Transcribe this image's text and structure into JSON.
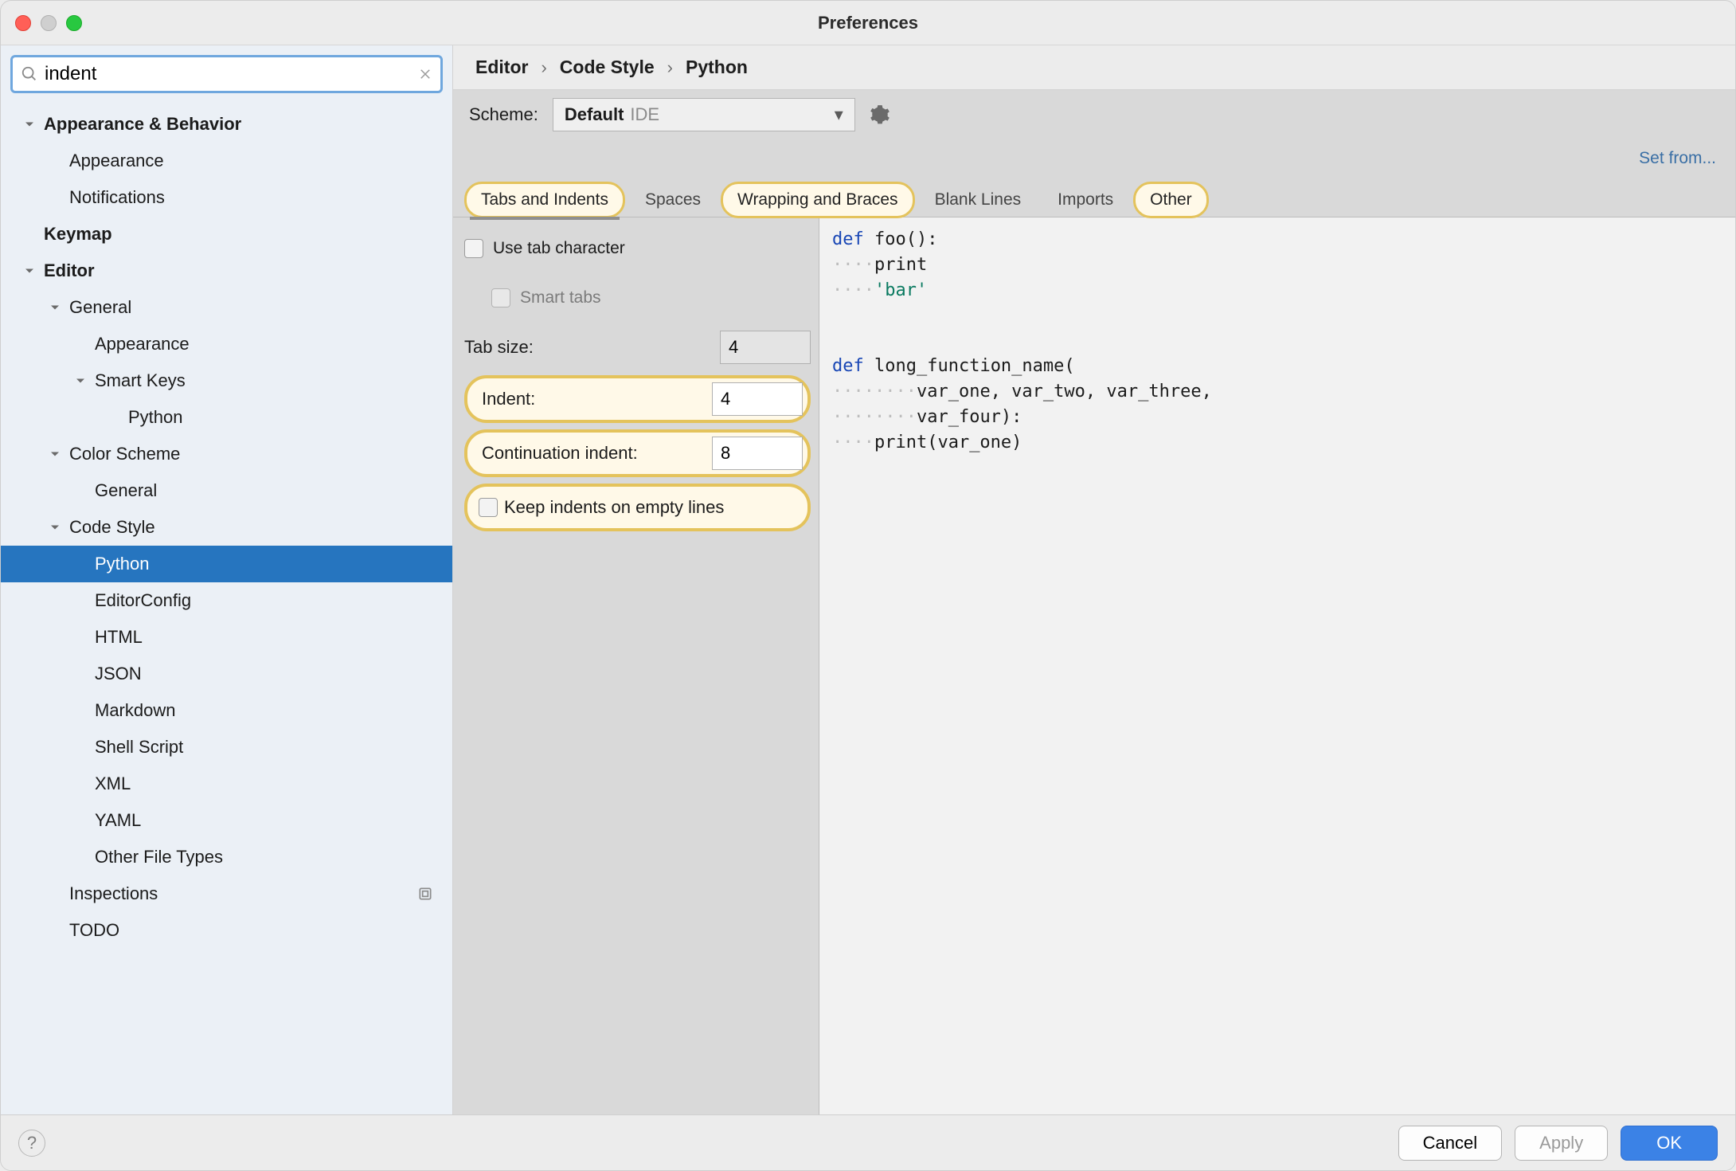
{
  "window": {
    "title": "Preferences"
  },
  "search": {
    "value": "indent"
  },
  "sidebar": {
    "items": [
      {
        "label": "Appearance & Behavior",
        "level": 0,
        "bold": true,
        "expandable": true
      },
      {
        "label": "Appearance",
        "level": 1
      },
      {
        "label": "Notifications",
        "level": 1
      },
      {
        "label": "Keymap",
        "level": 0,
        "bold": true
      },
      {
        "label": "Editor",
        "level": 0,
        "bold": true,
        "expandable": true
      },
      {
        "label": "General",
        "level": 1,
        "expandable": true
      },
      {
        "label": "Appearance",
        "level": 2
      },
      {
        "label": "Smart Keys",
        "level": 2,
        "expandable": true
      },
      {
        "label": "Python",
        "level": 3
      },
      {
        "label": "Color Scheme",
        "level": 1,
        "expandable": true
      },
      {
        "label": "General",
        "level": 2
      },
      {
        "label": "Code Style",
        "level": 1,
        "expandable": true
      },
      {
        "label": "Python",
        "level": 2,
        "selected": true
      },
      {
        "label": "EditorConfig",
        "level": 2
      },
      {
        "label": "HTML",
        "level": 2
      },
      {
        "label": "JSON",
        "level": 2
      },
      {
        "label": "Markdown",
        "level": 2
      },
      {
        "label": "Shell Script",
        "level": 2
      },
      {
        "label": "XML",
        "level": 2
      },
      {
        "label": "YAML",
        "level": 2
      },
      {
        "label": "Other File Types",
        "level": 2
      },
      {
        "label": "Inspections",
        "level": 1,
        "special": true
      },
      {
        "label": "TODO",
        "level": 1
      }
    ]
  },
  "breadcrumb": [
    "Editor",
    "Code Style",
    "Python"
  ],
  "scheme": {
    "label": "Scheme:",
    "value": "Default",
    "scope": "IDE"
  },
  "setfrom": "Set from...",
  "tabs": [
    {
      "label": "Tabs and Indents",
      "match": true,
      "selected": true
    },
    {
      "label": "Spaces"
    },
    {
      "label": "Wrapping and Braces",
      "match": true
    },
    {
      "label": "Blank Lines"
    },
    {
      "label": "Imports"
    },
    {
      "label": "Other",
      "match": true
    }
  ],
  "form": {
    "use_tab": "Use tab character",
    "smart_tabs": "Smart tabs",
    "tab_size_label": "Tab size:",
    "tab_size": "4",
    "indent_label": "Indent:",
    "indent": "4",
    "cont_label": "Continuation indent:",
    "cont": "8",
    "keep_empty": "Keep indents on empty lines"
  },
  "preview": {
    "l1a": "def",
    "l1b": " foo():",
    "l2d": "····",
    "l2": "print",
    "l3d": "····",
    "l3": "'bar'",
    "l5a": "def",
    "l5b": " long_function_name(",
    "l6d": "········",
    "l6": "var_one, var_two, var_three,",
    "l7d": "········",
    "l7": "var_four):",
    "l8d": "····",
    "l8": "print(var_one)"
  },
  "footer": {
    "cancel": "Cancel",
    "apply": "Apply",
    "ok": "OK"
  }
}
